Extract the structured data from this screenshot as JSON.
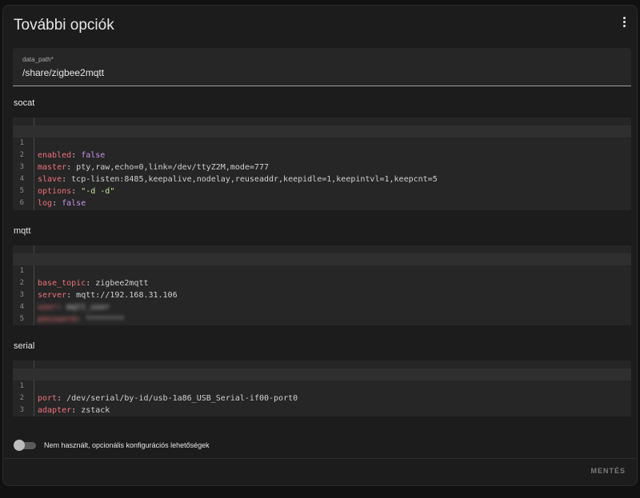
{
  "card": {
    "title": "További opciók",
    "menu_icon": "more-vertical-icon"
  },
  "data_path": {
    "label": "data_path*",
    "value": "/share/zigbee2mqtt"
  },
  "sections": {
    "socat": {
      "title": "socat",
      "line_numbers": [
        "1",
        "2",
        "3",
        "4",
        "5",
        "6"
      ],
      "lines": [
        {
          "key": "enabled",
          "sep": ": ",
          "value": "false"
        },
        {
          "key": "master",
          "sep": ": ",
          "value": "pty,raw,echo=0,link=/dev/ttyZ2M,mode=777"
        },
        {
          "key": "slave",
          "sep": ": ",
          "value": "tcp-listen:8485,keepalive,nodelay,reuseaddr,keepidle=1,keepintvl=1,keepcnt=5"
        },
        {
          "key": "options",
          "sep": ": ",
          "value": "\"-d -d\""
        },
        {
          "key": "log",
          "sep": ": ",
          "value": "false"
        },
        {
          "key": "",
          "sep": "",
          "value": ""
        }
      ]
    },
    "mqtt": {
      "title": "mqtt",
      "line_numbers": [
        "1",
        "2",
        "3",
        "4",
        "5"
      ],
      "lines": [
        {
          "key": "base_topic",
          "sep": ": ",
          "value": "zigbee2mqtt"
        },
        {
          "key": "server",
          "sep": ": ",
          "value": "mqtt://192.168.31.106"
        },
        {
          "key": "user",
          "sep": ": ",
          "value": "mqtt_user"
        },
        {
          "key": "password",
          "sep": ": ",
          "value": "********"
        },
        {
          "key": "",
          "sep": "",
          "value": ""
        }
      ]
    },
    "serial": {
      "title": "serial",
      "line_numbers": [
        "1",
        "2",
        "3"
      ],
      "lines": [
        {
          "key": "port",
          "sep": ": ",
          "value": "/dev/serial/by-id/usb-1a86_USB_Serial-if00-port0"
        },
        {
          "key": "adapter",
          "sep": ": ",
          "value": "zstack"
        },
        {
          "key": "",
          "sep": "",
          "value": ""
        }
      ]
    }
  },
  "toggle": {
    "label": "Nem használt, opcionális konfigurációs lehetőségek",
    "checked": false
  },
  "actions": {
    "save_label": "MENTÉS"
  },
  "colors": {
    "key": "#f07178",
    "boolean": "#c792ea",
    "string": "#c3e88d",
    "plain": "#d0d0d0",
    "background": "#1c1c1c"
  }
}
